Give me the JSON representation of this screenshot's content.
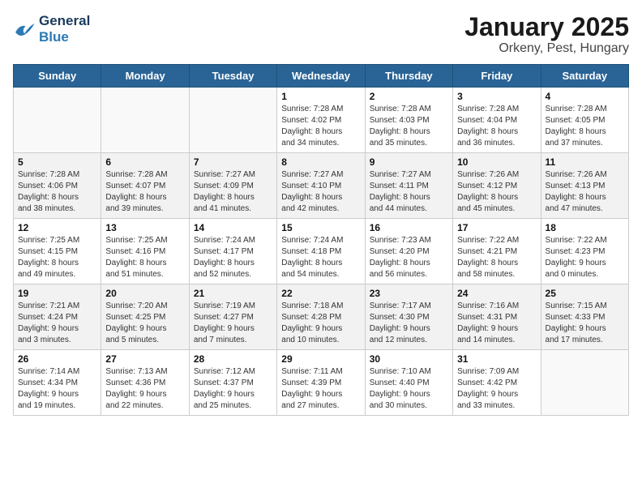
{
  "header": {
    "logo_line1": "General",
    "logo_line2": "Blue",
    "title": "January 2025",
    "subtitle": "Orkeny, Pest, Hungary"
  },
  "weekdays": [
    "Sunday",
    "Monday",
    "Tuesday",
    "Wednesday",
    "Thursday",
    "Friday",
    "Saturday"
  ],
  "weeks": [
    [
      {
        "day": "",
        "info": ""
      },
      {
        "day": "",
        "info": ""
      },
      {
        "day": "",
        "info": ""
      },
      {
        "day": "1",
        "info": "Sunrise: 7:28 AM\nSunset: 4:02 PM\nDaylight: 8 hours\nand 34 minutes."
      },
      {
        "day": "2",
        "info": "Sunrise: 7:28 AM\nSunset: 4:03 PM\nDaylight: 8 hours\nand 35 minutes."
      },
      {
        "day": "3",
        "info": "Sunrise: 7:28 AM\nSunset: 4:04 PM\nDaylight: 8 hours\nand 36 minutes."
      },
      {
        "day": "4",
        "info": "Sunrise: 7:28 AM\nSunset: 4:05 PM\nDaylight: 8 hours\nand 37 minutes."
      }
    ],
    [
      {
        "day": "5",
        "info": "Sunrise: 7:28 AM\nSunset: 4:06 PM\nDaylight: 8 hours\nand 38 minutes."
      },
      {
        "day": "6",
        "info": "Sunrise: 7:28 AM\nSunset: 4:07 PM\nDaylight: 8 hours\nand 39 minutes."
      },
      {
        "day": "7",
        "info": "Sunrise: 7:27 AM\nSunset: 4:09 PM\nDaylight: 8 hours\nand 41 minutes."
      },
      {
        "day": "8",
        "info": "Sunrise: 7:27 AM\nSunset: 4:10 PM\nDaylight: 8 hours\nand 42 minutes."
      },
      {
        "day": "9",
        "info": "Sunrise: 7:27 AM\nSunset: 4:11 PM\nDaylight: 8 hours\nand 44 minutes."
      },
      {
        "day": "10",
        "info": "Sunrise: 7:26 AM\nSunset: 4:12 PM\nDaylight: 8 hours\nand 45 minutes."
      },
      {
        "day": "11",
        "info": "Sunrise: 7:26 AM\nSunset: 4:13 PM\nDaylight: 8 hours\nand 47 minutes."
      }
    ],
    [
      {
        "day": "12",
        "info": "Sunrise: 7:25 AM\nSunset: 4:15 PM\nDaylight: 8 hours\nand 49 minutes."
      },
      {
        "day": "13",
        "info": "Sunrise: 7:25 AM\nSunset: 4:16 PM\nDaylight: 8 hours\nand 51 minutes."
      },
      {
        "day": "14",
        "info": "Sunrise: 7:24 AM\nSunset: 4:17 PM\nDaylight: 8 hours\nand 52 minutes."
      },
      {
        "day": "15",
        "info": "Sunrise: 7:24 AM\nSunset: 4:18 PM\nDaylight: 8 hours\nand 54 minutes."
      },
      {
        "day": "16",
        "info": "Sunrise: 7:23 AM\nSunset: 4:20 PM\nDaylight: 8 hours\nand 56 minutes."
      },
      {
        "day": "17",
        "info": "Sunrise: 7:22 AM\nSunset: 4:21 PM\nDaylight: 8 hours\nand 58 minutes."
      },
      {
        "day": "18",
        "info": "Sunrise: 7:22 AM\nSunset: 4:23 PM\nDaylight: 9 hours\nand 0 minutes."
      }
    ],
    [
      {
        "day": "19",
        "info": "Sunrise: 7:21 AM\nSunset: 4:24 PM\nDaylight: 9 hours\nand 3 minutes."
      },
      {
        "day": "20",
        "info": "Sunrise: 7:20 AM\nSunset: 4:25 PM\nDaylight: 9 hours\nand 5 minutes."
      },
      {
        "day": "21",
        "info": "Sunrise: 7:19 AM\nSunset: 4:27 PM\nDaylight: 9 hours\nand 7 minutes."
      },
      {
        "day": "22",
        "info": "Sunrise: 7:18 AM\nSunset: 4:28 PM\nDaylight: 9 hours\nand 10 minutes."
      },
      {
        "day": "23",
        "info": "Sunrise: 7:17 AM\nSunset: 4:30 PM\nDaylight: 9 hours\nand 12 minutes."
      },
      {
        "day": "24",
        "info": "Sunrise: 7:16 AM\nSunset: 4:31 PM\nDaylight: 9 hours\nand 14 minutes."
      },
      {
        "day": "25",
        "info": "Sunrise: 7:15 AM\nSunset: 4:33 PM\nDaylight: 9 hours\nand 17 minutes."
      }
    ],
    [
      {
        "day": "26",
        "info": "Sunrise: 7:14 AM\nSunset: 4:34 PM\nDaylight: 9 hours\nand 19 minutes."
      },
      {
        "day": "27",
        "info": "Sunrise: 7:13 AM\nSunset: 4:36 PM\nDaylight: 9 hours\nand 22 minutes."
      },
      {
        "day": "28",
        "info": "Sunrise: 7:12 AM\nSunset: 4:37 PM\nDaylight: 9 hours\nand 25 minutes."
      },
      {
        "day": "29",
        "info": "Sunrise: 7:11 AM\nSunset: 4:39 PM\nDaylight: 9 hours\nand 27 minutes."
      },
      {
        "day": "30",
        "info": "Sunrise: 7:10 AM\nSunset: 4:40 PM\nDaylight: 9 hours\nand 30 minutes."
      },
      {
        "day": "31",
        "info": "Sunrise: 7:09 AM\nSunset: 4:42 PM\nDaylight: 9 hours\nand 33 minutes."
      },
      {
        "day": "",
        "info": ""
      }
    ]
  ]
}
